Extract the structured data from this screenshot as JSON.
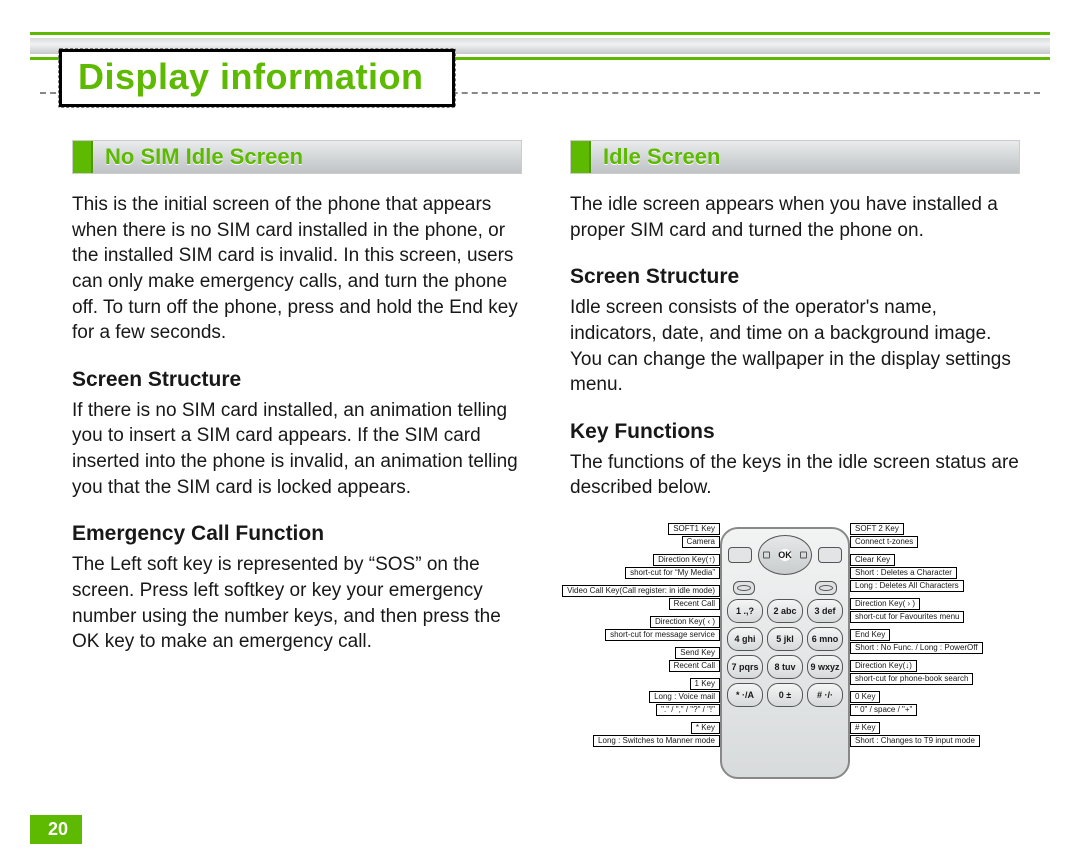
{
  "page_number": "20",
  "title": "Display information",
  "left": {
    "head": "No SIM Idle Screen",
    "intro": "This is the initial screen of the phone that appears when there is no SIM card installed in the phone, or the installed SIM card is invalid. In this screen, users can only make emergency calls, and turn the phone off. To turn off the phone, press and hold the End key for a few seconds.",
    "sub1": "Screen Structure",
    "body1": "If there is no SIM card installed, an animation telling you to insert a SIM card appears. If the SIM card inserted into the phone is invalid, an animation telling you that the SIM card is locked appears.",
    "sub2": "Emergency Call Function",
    "body2": "The Left soft key is represented by “SOS” on the screen. Press left softkey or key your emergency number using the number keys, and then press the OK key to make an emergency call."
  },
  "right": {
    "head": "Idle Screen",
    "intro": "The idle screen appears when you have installed a proper SIM card and turned the phone on.",
    "sub1": "Screen Structure",
    "body1": "Idle screen consists of the operator's name, indicators, date, and time on a background image. You can change the wallpaper in the display settings menu.",
    "sub2": "Key Functions",
    "body2": "The functions of the keys in the idle screen status are described below."
  },
  "phone": {
    "ok": "OK",
    "keys": [
      "1 .,?",
      "2 abc",
      "3 def",
      "4 ghi",
      "5 jkl",
      "6 mno",
      "7 pqrs",
      "8 tuv",
      "9 wxyz",
      "* ·/A",
      "0 ±",
      "# ·/·"
    ]
  },
  "callouts": {
    "left": [
      [
        "SOFT1 Key",
        "Camera"
      ],
      [
        "Direction Key(↑)",
        "short-cut for “My Media”"
      ],
      [
        "Video Call Key(Call register: in idle mode)",
        "Recent Call"
      ],
      [
        "Direction Key( ‹ )",
        "short-cut for message service"
      ],
      [
        "Send Key",
        "Recent Call"
      ],
      [
        "1 Key",
        "Long : Voice mail",
        "\".\" / \",\" / \"?\" / \"!\" "
      ],
      [
        "* Key",
        "Long : Switches to Manner mode"
      ]
    ],
    "right": [
      [
        "SOFT 2 Key",
        "Connect t-zones"
      ],
      [
        "Clear Key",
        "Short : Deletes a Character",
        "Long : Deletes All Characters"
      ],
      [
        "Direction Key( › )",
        "short-cut for Favourites menu"
      ],
      [
        "End Key",
        "Short : No Func. / Long : PowerOff"
      ],
      [
        "Direction Key(↓)",
        "short-cut for phone-book search"
      ],
      [
        "0 Key",
        "\" 0\"   /   space   /   \"+\""
      ],
      [
        "# Key",
        "Short : Changes to T9 input mode"
      ]
    ]
  }
}
